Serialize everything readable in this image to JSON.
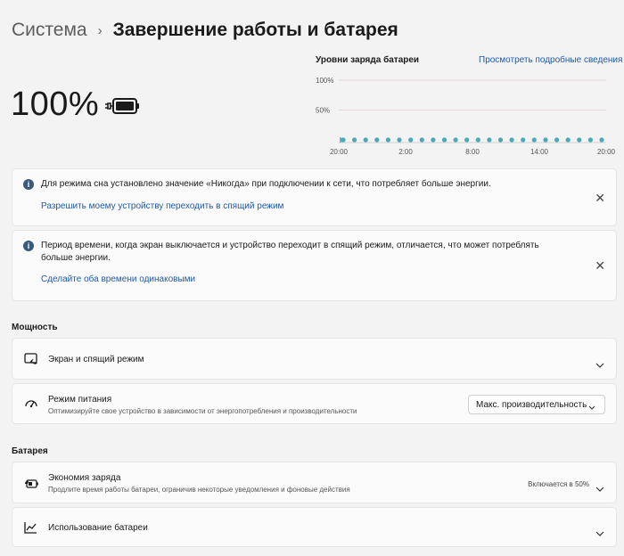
{
  "breadcrumb": {
    "parent": "Система",
    "separator": "›",
    "current": "Завершение работы и батарея"
  },
  "battery": {
    "percent_text": "100%",
    "level_percent": 100
  },
  "chart_data": {
    "type": "scatter",
    "title": "Уровни заряда батареи",
    "link": "Просмотреть подробные сведения",
    "y_ticks": [
      "100%",
      "50%"
    ],
    "x_ticks": [
      "20:00",
      "2:00",
      "8:00",
      "14:00",
      "20:00"
    ],
    "ylim": [
      0,
      100
    ],
    "series": [
      {
        "values": [
          0,
          0,
          0,
          0,
          0,
          0,
          0,
          0,
          0,
          0,
          0,
          0,
          0,
          0,
          0,
          0,
          0,
          0,
          0,
          0,
          0,
          0,
          0,
          0
        ]
      }
    ],
    "colors": {
      "point": "#4aa8b8",
      "grid": "#e6d6d6",
      "axis": "#d0d0d0"
    }
  },
  "notices": [
    {
      "text": "Для режима сна установлено значение «Никогда» при подключении к сети, что потребляет больше энергии.",
      "link": "Разрешить моему устройству переходить в спящий режим"
    },
    {
      "text": "Период времени, когда экран выключается и устройство переходит в спящий режим, отличается, что может потреблять больше энергии.",
      "link": "Сделайте оба времени одинаковыми"
    }
  ],
  "power": {
    "header": "Мощность",
    "screen_sleep": {
      "title": "Экран и спящий режим"
    },
    "power_mode": {
      "title": "Режим питания",
      "desc": "Оптимизируйте свое устройство в зависимости от энергопотребления и производительности",
      "selected": "Макс. производительность"
    }
  },
  "battery_section": {
    "header": "Батарея",
    "saver": {
      "title": "Экономия заряда",
      "desc": "Продлите время работы батареи, ограничив некоторые уведомления и фоновые действия",
      "value": "Включается в 50%"
    },
    "usage": {
      "title": "Использование батареи"
    }
  }
}
